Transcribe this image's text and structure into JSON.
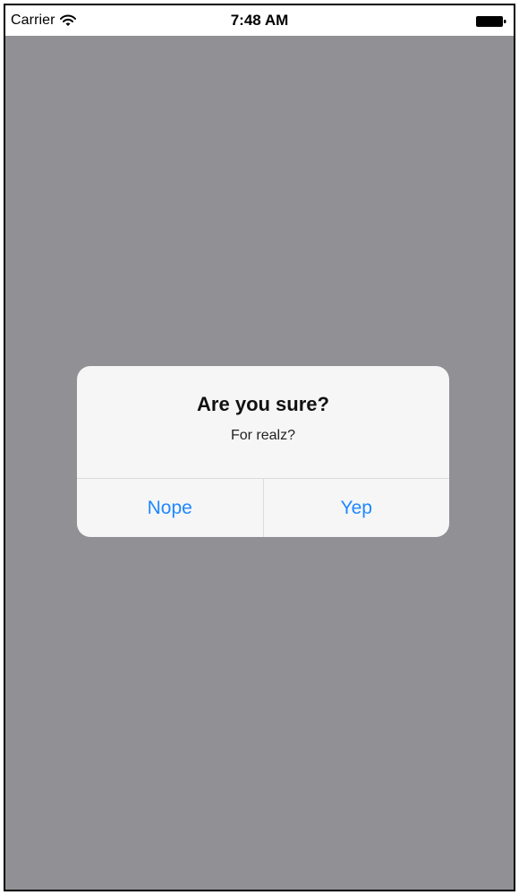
{
  "status_bar": {
    "carrier": "Carrier",
    "time": "7:48 AM",
    "wifi_icon": "wifi-icon",
    "battery_icon": "battery-icon"
  },
  "alert": {
    "title": "Are you sure?",
    "message": "For realz?",
    "buttons": [
      {
        "label": "Nope"
      },
      {
        "label": "Yep"
      }
    ]
  },
  "colors": {
    "overlay": "#919095",
    "alert_background": "#f6f6f6",
    "button_text": "#1e88ff",
    "divider": "#dddde0"
  }
}
